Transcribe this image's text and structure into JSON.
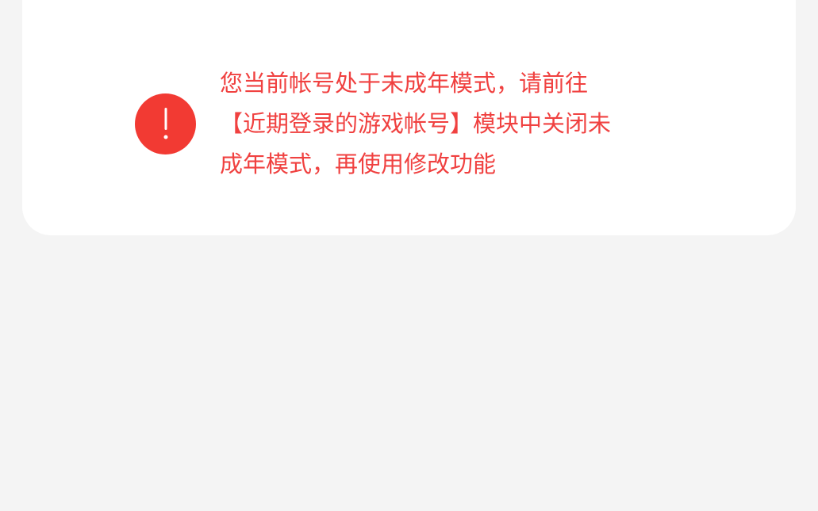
{
  "card": {
    "heading_partial": "",
    "notice": {
      "icon": "exclamation-icon",
      "icon_color": "#f23a33",
      "text_color": "#f04140",
      "lines": [
        "您当前帐号处于未成年模式，请前往",
        "【近期登录的游戏帐号】模块中关闭未",
        "成年模式，再使用修改功能"
      ]
    }
  },
  "colors": {
    "page_background": "#f4f4f4",
    "card_background": "#ffffff"
  }
}
